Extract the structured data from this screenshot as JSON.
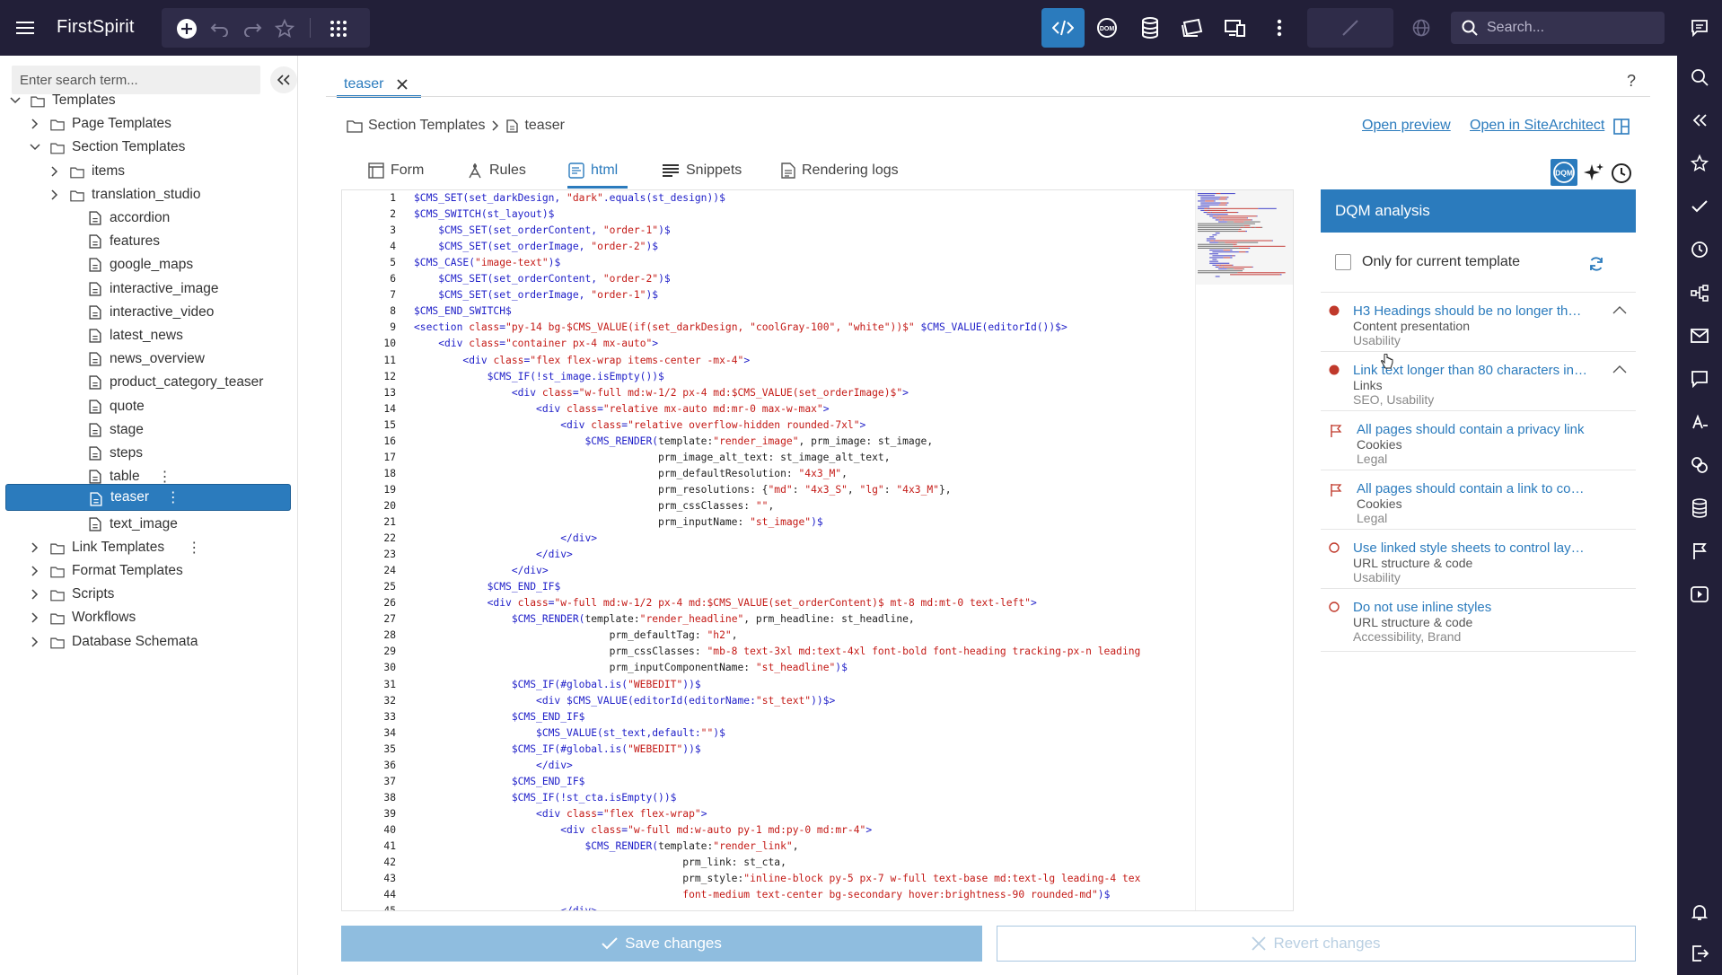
{
  "app": {
    "title": "FirstSpirit"
  },
  "topbar": {
    "search_placeholder": "Search..."
  },
  "sidebar": {
    "search_placeholder": "Enter search term...",
    "tree": [
      {
        "label": "Templates",
        "level": 0,
        "type": "folder",
        "expanded": true
      },
      {
        "label": "Page Templates",
        "level": 1,
        "type": "folder",
        "expanded": false
      },
      {
        "label": "Section Templates",
        "level": 1,
        "type": "folder",
        "expanded": true
      },
      {
        "label": "items",
        "level": 2,
        "type": "folder",
        "expanded": false
      },
      {
        "label": "translation_studio",
        "level": 2,
        "type": "folder",
        "expanded": false
      },
      {
        "label": "accordion",
        "level": 2,
        "type": "file"
      },
      {
        "label": "features",
        "level": 2,
        "type": "file"
      },
      {
        "label": "google_maps",
        "level": 2,
        "type": "file"
      },
      {
        "label": "interactive_image",
        "level": 2,
        "type": "file"
      },
      {
        "label": "interactive_video",
        "level": 2,
        "type": "file"
      },
      {
        "label": "latest_news",
        "level": 2,
        "type": "file"
      },
      {
        "label": "news_overview",
        "level": 2,
        "type": "file"
      },
      {
        "label": "product_category_teaser",
        "level": 2,
        "type": "file"
      },
      {
        "label": "quote",
        "level": 2,
        "type": "file"
      },
      {
        "label": "stage",
        "level": 2,
        "type": "file"
      },
      {
        "label": "steps",
        "level": 2,
        "type": "file"
      },
      {
        "label": "table",
        "level": 2,
        "type": "file",
        "kebab": true
      },
      {
        "label": "teaser",
        "level": 2,
        "type": "file",
        "kebab": true,
        "selected": true
      },
      {
        "label": "text_image",
        "level": 2,
        "type": "file"
      },
      {
        "label": "Link Templates",
        "level": 1,
        "type": "folder",
        "expanded": false,
        "kebab": true
      },
      {
        "label": "Format Templates",
        "level": 1,
        "type": "folder",
        "expanded": false
      },
      {
        "label": "Scripts",
        "level": 1,
        "type": "folder",
        "expanded": false
      },
      {
        "label": "Workflows",
        "level": 1,
        "type": "folder",
        "expanded": false
      },
      {
        "label": "Database Schemata",
        "level": 1,
        "type": "folder",
        "expanded": false
      }
    ]
  },
  "tab": {
    "label": "teaser"
  },
  "breadcrumb": {
    "parent": "Section Templates",
    "current": "teaser"
  },
  "links": {
    "open_preview": "Open preview",
    "open_sitearchitect": "Open in SiteArchitect"
  },
  "subtabs": {
    "form": "Form",
    "rules": "Rules",
    "html": "html",
    "snippets": "Snippets",
    "rendering_logs": "Rendering logs"
  },
  "editor": {
    "lines": [
      [
        [
          "k",
          "$CMS_SET(set_darkDesign, "
        ],
        [
          "s",
          "\"dark\""
        ],
        [
          "k",
          ".equals(st_design))$"
        ]
      ],
      [
        [
          "k",
          "$CMS_SWITCH(st_layout)$"
        ]
      ],
      [
        [
          "p",
          "    "
        ],
        [
          "k",
          "$CMS_SET(set_orderContent, "
        ],
        [
          "s",
          "\"order-1\""
        ],
        [
          "k",
          ")$"
        ]
      ],
      [
        [
          "p",
          "    "
        ],
        [
          "k",
          "$CMS_SET(set_orderImage, "
        ],
        [
          "s",
          "\"order-2\""
        ],
        [
          "k",
          ")$"
        ]
      ],
      [
        [
          "k",
          "$CMS_CASE("
        ],
        [
          "s",
          "\"image-text\""
        ],
        [
          "k",
          ")$"
        ]
      ],
      [
        [
          "p",
          "    "
        ],
        [
          "k",
          "$CMS_SET(set_orderContent, "
        ],
        [
          "s",
          "\"order-2\""
        ],
        [
          "k",
          ")$"
        ]
      ],
      [
        [
          "p",
          "    "
        ],
        [
          "k",
          "$CMS_SET(set_orderImage, "
        ],
        [
          "s",
          "\"order-1\""
        ],
        [
          "k",
          ")$"
        ]
      ],
      [
        [
          "k",
          "$CMS_END_SWITCH$"
        ]
      ],
      [
        [
          "k",
          "<section "
        ],
        [
          "s",
          "class"
        ],
        [
          "k",
          "="
        ],
        [
          "s",
          "\"py-14 bg-$CMS_VALUE(if(set_darkDesign, \"coolGray-100\", \"white\"))$\""
        ],
        [
          "k",
          " $CMS_VALUE(editorId())$>"
        ]
      ],
      [
        [
          "p",
          "    "
        ],
        [
          "k",
          "<div "
        ],
        [
          "s",
          "class"
        ],
        [
          "k",
          "="
        ],
        [
          "s",
          "\"container px-4 mx-auto\""
        ],
        [
          "k",
          ">"
        ]
      ],
      [
        [
          "p",
          "        "
        ],
        [
          "k",
          "<div "
        ],
        [
          "s",
          "class"
        ],
        [
          "k",
          "="
        ],
        [
          "s",
          "\"flex flex-wrap items-center -mx-4\""
        ],
        [
          "k",
          ">"
        ]
      ],
      [
        [
          "p",
          "            "
        ],
        [
          "k",
          "$CMS_IF(!st_image.isEmpty())$"
        ]
      ],
      [
        [
          "p",
          "                "
        ],
        [
          "k",
          "<div "
        ],
        [
          "s",
          "class"
        ],
        [
          "k",
          "="
        ],
        [
          "s",
          "\"w-full md:w-1/2 px-4 md:$CMS_VALUE(set_orderImage)$\""
        ],
        [
          "k",
          ">"
        ]
      ],
      [
        [
          "p",
          "                    "
        ],
        [
          "k",
          "<div "
        ],
        [
          "s",
          "class"
        ],
        [
          "k",
          "="
        ],
        [
          "s",
          "\"relative mx-auto md:mr-0 max-w-max\""
        ],
        [
          "k",
          ">"
        ]
      ],
      [
        [
          "p",
          "                        "
        ],
        [
          "k",
          "<div "
        ],
        [
          "s",
          "class"
        ],
        [
          "k",
          "="
        ],
        [
          "s",
          "\"relative overflow-hidden rounded-7xl\""
        ],
        [
          "k",
          ">"
        ]
      ],
      [
        [
          "p",
          "                            "
        ],
        [
          "k",
          "$CMS_RENDER("
        ],
        [
          "p",
          "template:"
        ],
        [
          "s",
          "\"render_image\""
        ],
        [
          "p",
          ", prm_image: st_image,"
        ]
      ],
      [
        [
          "p",
          "                                        prm_image_alt_text: st_image_alt_text,"
        ]
      ],
      [
        [
          "p",
          "                                        prm_defaultResolution: "
        ],
        [
          "s",
          "\"4x3_M\""
        ],
        [
          "p",
          ","
        ]
      ],
      [
        [
          "p",
          "                                        prm_resolutions: {"
        ],
        [
          "s",
          "\"md\""
        ],
        [
          "p",
          ": "
        ],
        [
          "s",
          "\"4x3_S\""
        ],
        [
          "p",
          ", "
        ],
        [
          "s",
          "\"lg\""
        ],
        [
          "p",
          ": "
        ],
        [
          "s",
          "\"4x3_M\""
        ],
        [
          "p",
          "},"
        ]
      ],
      [
        [
          "p",
          "                                        prm_cssClasses: "
        ],
        [
          "s",
          "\"\""
        ],
        [
          "p",
          ","
        ]
      ],
      [
        [
          "p",
          "                                        prm_inputName: "
        ],
        [
          "s",
          "\"st_image\""
        ],
        [
          "k",
          ")$"
        ]
      ],
      [
        [
          "p",
          "                        "
        ],
        [
          "k",
          "</div>"
        ]
      ],
      [
        [
          "p",
          "                    "
        ],
        [
          "k",
          "</div>"
        ]
      ],
      [
        [
          "p",
          "                "
        ],
        [
          "k",
          "</div>"
        ]
      ],
      [
        [
          "p",
          "            "
        ],
        [
          "k",
          "$CMS_END_IF$"
        ]
      ],
      [
        [
          "p",
          "            "
        ],
        [
          "k",
          "<div "
        ],
        [
          "s",
          "class"
        ],
        [
          "k",
          "="
        ],
        [
          "s",
          "\"w-full md:w-1/2 px-4 md:$CMS_VALUE(set_orderContent)$ mt-8 md:mt-0 text-left\""
        ],
        [
          "k",
          ">"
        ]
      ],
      [
        [
          "p",
          "                "
        ],
        [
          "k",
          "$CMS_RENDER("
        ],
        [
          "p",
          "template:"
        ],
        [
          "s",
          "\"render_headline\""
        ],
        [
          "p",
          ", prm_headline: st_headline,"
        ]
      ],
      [
        [
          "p",
          "                                prm_defaultTag: "
        ],
        [
          "s",
          "\"h2\""
        ],
        [
          "p",
          ","
        ]
      ],
      [
        [
          "p",
          "                                prm_cssClasses: "
        ],
        [
          "s",
          "\"mb-8 text-3xl md:text-4xl font-bold font-heading tracking-px-n leading"
        ]
      ],
      [
        [
          "p",
          "                                prm_inputComponentName: "
        ],
        [
          "s",
          "\"st_headline\""
        ],
        [
          "k",
          ")$"
        ]
      ],
      [
        [
          "p",
          "                "
        ],
        [
          "k",
          "$CMS_IF(#global.is("
        ],
        [
          "s",
          "\"WEBEDIT\""
        ],
        [
          "k",
          "))$"
        ]
      ],
      [
        [
          "p",
          "                    "
        ],
        [
          "k",
          "<div $CMS_VALUE(editorId(editorName:"
        ],
        [
          "s",
          "\"st_text\""
        ],
        [
          "k",
          "))$>"
        ]
      ],
      [
        [
          "p",
          "                "
        ],
        [
          "k",
          "$CMS_END_IF$"
        ]
      ],
      [
        [
          "p",
          "                    "
        ],
        [
          "k",
          "$CMS_VALUE(st_text,default:"
        ],
        [
          "s",
          "\"\""
        ],
        [
          "k",
          ")$"
        ]
      ],
      [
        [
          "p",
          "                "
        ],
        [
          "k",
          "$CMS_IF(#global.is("
        ],
        [
          "s",
          "\"WEBEDIT\""
        ],
        [
          "k",
          "))$"
        ]
      ],
      [
        [
          "p",
          "                    "
        ],
        [
          "k",
          "</div>"
        ]
      ],
      [
        [
          "p",
          "                "
        ],
        [
          "k",
          "$CMS_END_IF$"
        ]
      ],
      [
        [
          "p",
          "                "
        ],
        [
          "k",
          "$CMS_IF(!st_cta.isEmpty())$"
        ]
      ],
      [
        [
          "p",
          "                    "
        ],
        [
          "k",
          "<div "
        ],
        [
          "s",
          "class"
        ],
        [
          "k",
          "="
        ],
        [
          "s",
          "\"flex flex-wrap\""
        ],
        [
          "k",
          ">"
        ]
      ],
      [
        [
          "p",
          "                        "
        ],
        [
          "k",
          "<div "
        ],
        [
          "s",
          "class"
        ],
        [
          "k",
          "="
        ],
        [
          "s",
          "\"w-full md:w-auto py-1 md:py-0 md:mr-4\""
        ],
        [
          "k",
          ">"
        ]
      ],
      [
        [
          "p",
          "                            "
        ],
        [
          "k",
          "$CMS_RENDER("
        ],
        [
          "p",
          "template:"
        ],
        [
          "s",
          "\"render_link\""
        ],
        [
          "p",
          ","
        ]
      ],
      [
        [
          "p",
          "                                            prm_link: st_cta,"
        ]
      ],
      [
        [
          "p",
          "                                            prm_style:"
        ],
        [
          "s",
          "\"inline-block py-5 px-7 w-full text-base md:text-lg leading-4 tex"
        ]
      ],
      [
        [
          "p",
          "                                            "
        ],
        [
          "s",
          "font-medium text-center bg-secondary hover:brightness-90 rounded-md\""
        ],
        [
          "k",
          ")$"
        ]
      ],
      [
        [
          "p",
          "                        "
        ],
        [
          "k",
          "</div>"
        ]
      ]
    ]
  },
  "dqm": {
    "title": "DQM analysis",
    "only_current": "Only for current template",
    "items": [
      {
        "title": "H3 Headings should be no longer th…",
        "category": "Content presentation",
        "tags": "Usability",
        "severity": "error",
        "collapsible": true
      },
      {
        "title": "Link text longer than 80 characters in…",
        "category": "Links",
        "tags": "SEO, Usability",
        "severity": "error",
        "collapsible": true
      },
      {
        "title": "All pages should contain a privacy link",
        "category": "Cookies",
        "tags": "Legal",
        "severity": "flag",
        "collapsible": false
      },
      {
        "title": "All pages should contain a link to co…",
        "category": "Cookies",
        "tags": "Legal",
        "severity": "flag",
        "collapsible": false
      },
      {
        "title": "Use linked style sheets to control lay…",
        "category": "URL structure & code",
        "tags": "Usability",
        "severity": "info",
        "collapsible": false
      },
      {
        "title": "Do not use inline styles",
        "category": "URL structure & code",
        "tags": "Accessibility, Brand",
        "severity": "info",
        "collapsible": false
      }
    ]
  },
  "buttons": {
    "save": "Save changes",
    "revert": "Revert changes"
  },
  "colors": {
    "topbar": "#221f38",
    "accent": "#2b7bbd",
    "error": "#c0392b",
    "code_keyword": "#1e1ec8",
    "code_string": "#c41a16"
  }
}
